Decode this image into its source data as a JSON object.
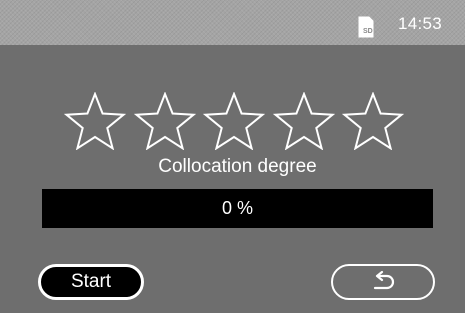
{
  "status_bar": {
    "icon": "sd-card-icon",
    "time": "14:53"
  },
  "rating": {
    "max_stars": 5,
    "filled_stars": 0,
    "icon": "star-outline-icon"
  },
  "caption": "Collocation degree",
  "progress": {
    "value": 0,
    "label": "0 %"
  },
  "buttons": {
    "start_label": "Start",
    "back_icon": "return-arrow-icon"
  },
  "colors": {
    "background": "#6e6e6e",
    "status_bar": "#a4a4a4",
    "text": "#ffffff",
    "progress_track": "#000000"
  }
}
